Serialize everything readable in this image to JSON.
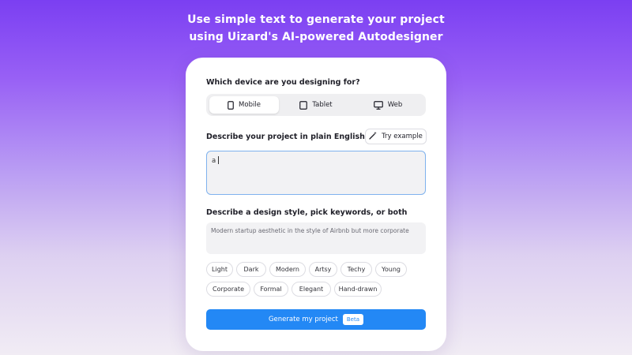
{
  "headline": {
    "line1": "Use simple text to generate your project",
    "line2": "using Uizard's AI-powered Autodesigner"
  },
  "device": {
    "label": "Which device are you designing for?",
    "options": [
      {
        "label": "Mobile",
        "icon": "mobile-icon",
        "selected": true
      },
      {
        "label": "Tablet",
        "icon": "tablet-icon",
        "selected": false
      },
      {
        "label": "Web",
        "icon": "monitor-icon",
        "selected": false
      }
    ]
  },
  "project": {
    "label": "Describe your project in plain English",
    "try_example": "Try example",
    "try_icon": "magic-wand-icon",
    "value": "a"
  },
  "style": {
    "label": "Describe a design style, pick keywords, or both",
    "placeholder": "Modern startup aesthetic in the style of Airbnb but more corporate",
    "keywords": [
      "Light",
      "Dark",
      "Modern",
      "Artsy",
      "Techy",
      "Young",
      "Corporate",
      "Formal",
      "Elegant",
      "Hand-drawn"
    ]
  },
  "generate": {
    "label": "Generate my project",
    "badge": "Beta"
  },
  "colors": {
    "accent": "#2388f5",
    "focus_border": "#7fb2ee",
    "background_top": "#7b3ff2"
  }
}
